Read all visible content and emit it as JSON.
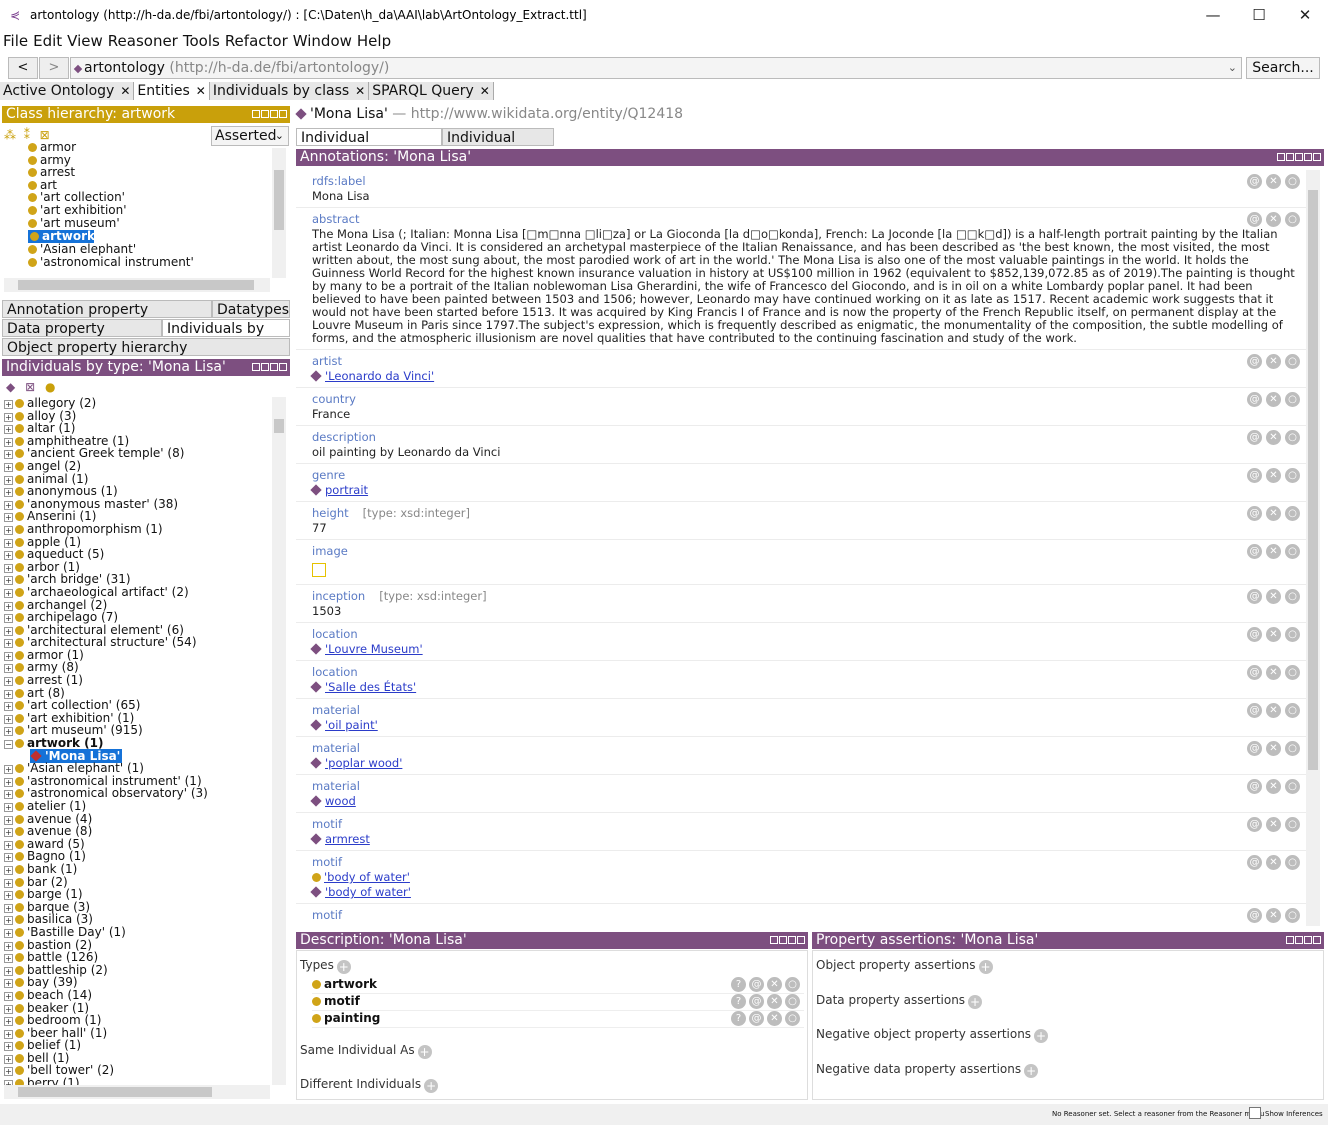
{
  "window": {
    "title": "artontology (http://h-da.de/fbi/artontology/)  : [C:\\Daten\\h_da\\AAI\\lab\\ArtOntology_Extract.ttl]",
    "minimize": "—",
    "maximize": "☐",
    "close": "✕"
  },
  "menu": [
    "File",
    "Edit",
    "View",
    "Reasoner",
    "Tools",
    "Refactor",
    "Window",
    "Help"
  ],
  "nav": {
    "back": "<",
    "forward": ">",
    "ontology_name": "artontology",
    "ontology_iri": "(http://h-da.de/fbi/artontology/)",
    "search": "Search..."
  },
  "tabs": [
    {
      "label": "Active Ontology"
    },
    {
      "label": "Entities"
    },
    {
      "label": "Individuals by class"
    },
    {
      "label": "SPARQL Query"
    }
  ],
  "class_hierarchy": {
    "title": "Class hierarchy: artwork",
    "mode": "Asserted",
    "items": [
      "armor",
      "army",
      "arrest",
      "art",
      "'art collection'",
      "'art exhibition'",
      "'art museum'",
      "artwork",
      "'Asian elephant'",
      "'astronomical instrument'"
    ],
    "selected": "artwork"
  },
  "grouped_tabs": {
    "annotation_property": "Annotation property hierarchy",
    "datatypes": "Datatypes",
    "data_property": "Data property hierarchy",
    "individuals_by_type": "Individuals by type",
    "object_property": "Object property hierarchy"
  },
  "individuals_by_type": {
    "title": "Individuals by type: 'Mona Lisa'",
    "items": [
      "allegory (2)",
      "alloy (3)",
      "altar (1)",
      "amphitheatre (1)",
      "'ancient Greek temple' (8)",
      "angel (2)",
      "animal (1)",
      "anonymous (1)",
      "'anonymous master' (38)",
      "Anserini (1)",
      "anthropomorphism (1)",
      "apple (1)",
      "aqueduct (5)",
      "arbor (1)",
      "'arch bridge' (31)",
      "'archaeological artifact' (2)",
      "archangel (2)",
      "archipelago (7)",
      "'architectural element' (6)",
      "'architectural structure' (54)",
      "armor (1)",
      "army (8)",
      "arrest (1)",
      "art (8)",
      "'art collection' (65)",
      "'art exhibition' (1)",
      "'art museum' (915)",
      "artwork (1)",
      "'Mona Lisa'",
      "'Asian elephant' (1)",
      "'astronomical instrument' (1)",
      "'astronomical observatory' (3)",
      "atelier (1)",
      "avenue (4)",
      "avenue (8)",
      "award (5)",
      "Bagno (1)",
      "bank (1)",
      "bar (2)",
      "barge (1)",
      "barque (3)",
      "basilica (3)",
      "'Bastille Day' (1)",
      "bastion (2)",
      "battle (126)",
      "battleship (2)",
      "bay (39)",
      "beach (14)",
      "beaker (1)",
      "bedroom (1)",
      "'beer hall' (1)",
      "belief (1)",
      "bell (1)",
      "'bell tower' (2)",
      "berry (1)"
    ]
  },
  "entity": {
    "name": "'Mona Lisa'",
    "dash": "—",
    "iri": "http://www.wikidata.org/entity/Q12418",
    "subtabs": [
      "Individual Annotations",
      "Individual Usage"
    ]
  },
  "annotations": {
    "title": "Annotations: 'Mona Lisa'",
    "items": [
      {
        "prop": "rdfs:label",
        "value": "Mona Lisa"
      },
      {
        "prop": "abstract",
        "value": "The Mona Lisa (; Italian: Monna Lisa [□m□nna □li□za] or La Gioconda [la d□o□konda], French: La Joconde [la □□k□d]) is a half-length portrait painting by the Italian artist Leonardo da Vinci. It is considered an archetypal masterpiece of the Italian Renaissance, and has been described as 'the best known, the most visited, the most written about, the most sung about, the most parodied work of art in the world.' The Mona Lisa is also one of the most valuable paintings in the world. It holds the Guinness World Record for the highest known insurance valuation in history at US$100 million in 1962 (equivalent to $852,139,072.85 as of 2019).The painting is thought by many to be a portrait of  the Italian noblewoman Lisa Gherardini, the wife of Francesco del Giocondo, and is in oil on a white Lombardy poplar panel. It had been believed to have been painted between 1503 and 1506; however, Leonardo may have continued working on it as late as 1517. Recent academic work suggests that it would not have been started before 1513. It was acquired by King Francis I of France and is now the property of the French Republic itself, on permanent display at the Louvre Museum in Paris since 1797.The subject's expression, which is frequently described as enigmatic, the monumentality of the composition, the subtle modelling of forms, and the atmospheric illusionism are novel qualities that have contributed to the continuing fascination and study of the work."
      },
      {
        "prop": "artist",
        "link": "'Leonardo da Vinci'"
      },
      {
        "prop": "country",
        "value": "France"
      },
      {
        "prop": "description",
        "value": "oil painting by Leonardo da Vinci"
      },
      {
        "prop": "genre",
        "link": "portrait"
      },
      {
        "prop": "height",
        "type": "[type: xsd:integer]",
        "value": "77"
      },
      {
        "prop": "image"
      },
      {
        "prop": "inception",
        "type": "[type: xsd:integer]",
        "value": "1503"
      },
      {
        "prop": "location",
        "link": "'Louvre Museum'"
      },
      {
        "prop": "location",
        "link": "'Salle des États'"
      },
      {
        "prop": "material",
        "link": "'oil paint'"
      },
      {
        "prop": "material",
        "link": "'poplar wood'"
      },
      {
        "prop": "material",
        "link": "wood"
      },
      {
        "prop": "motif",
        "link": "armrest"
      },
      {
        "prop": "motif",
        "link": "'body of water'",
        "link2": "'body of water'"
      },
      {
        "prop": "motif"
      }
    ]
  },
  "description": {
    "title": "Description: 'Mona Lisa'",
    "types_label": "Types",
    "types": [
      "artwork",
      "motif",
      "painting"
    ],
    "same_individual": "Same Individual As",
    "different_individuals": "Different Individuals"
  },
  "property_assertions": {
    "title": "Property assertions: 'Mona Lisa'",
    "object": "Object property assertions",
    "data": "Data property assertions",
    "neg_object": "Negative object property assertions",
    "neg_data": "Negative data property assertions"
  },
  "status": {
    "reasoner": "No Reasoner set. Select a reasoner from the Reasoner menu",
    "show_inferences": "Show Inferences"
  },
  "colors": {
    "gold": "#c9a00b",
    "purple": "#7d4f80",
    "selection": "#1572d8",
    "link": "#2b3cc9"
  }
}
